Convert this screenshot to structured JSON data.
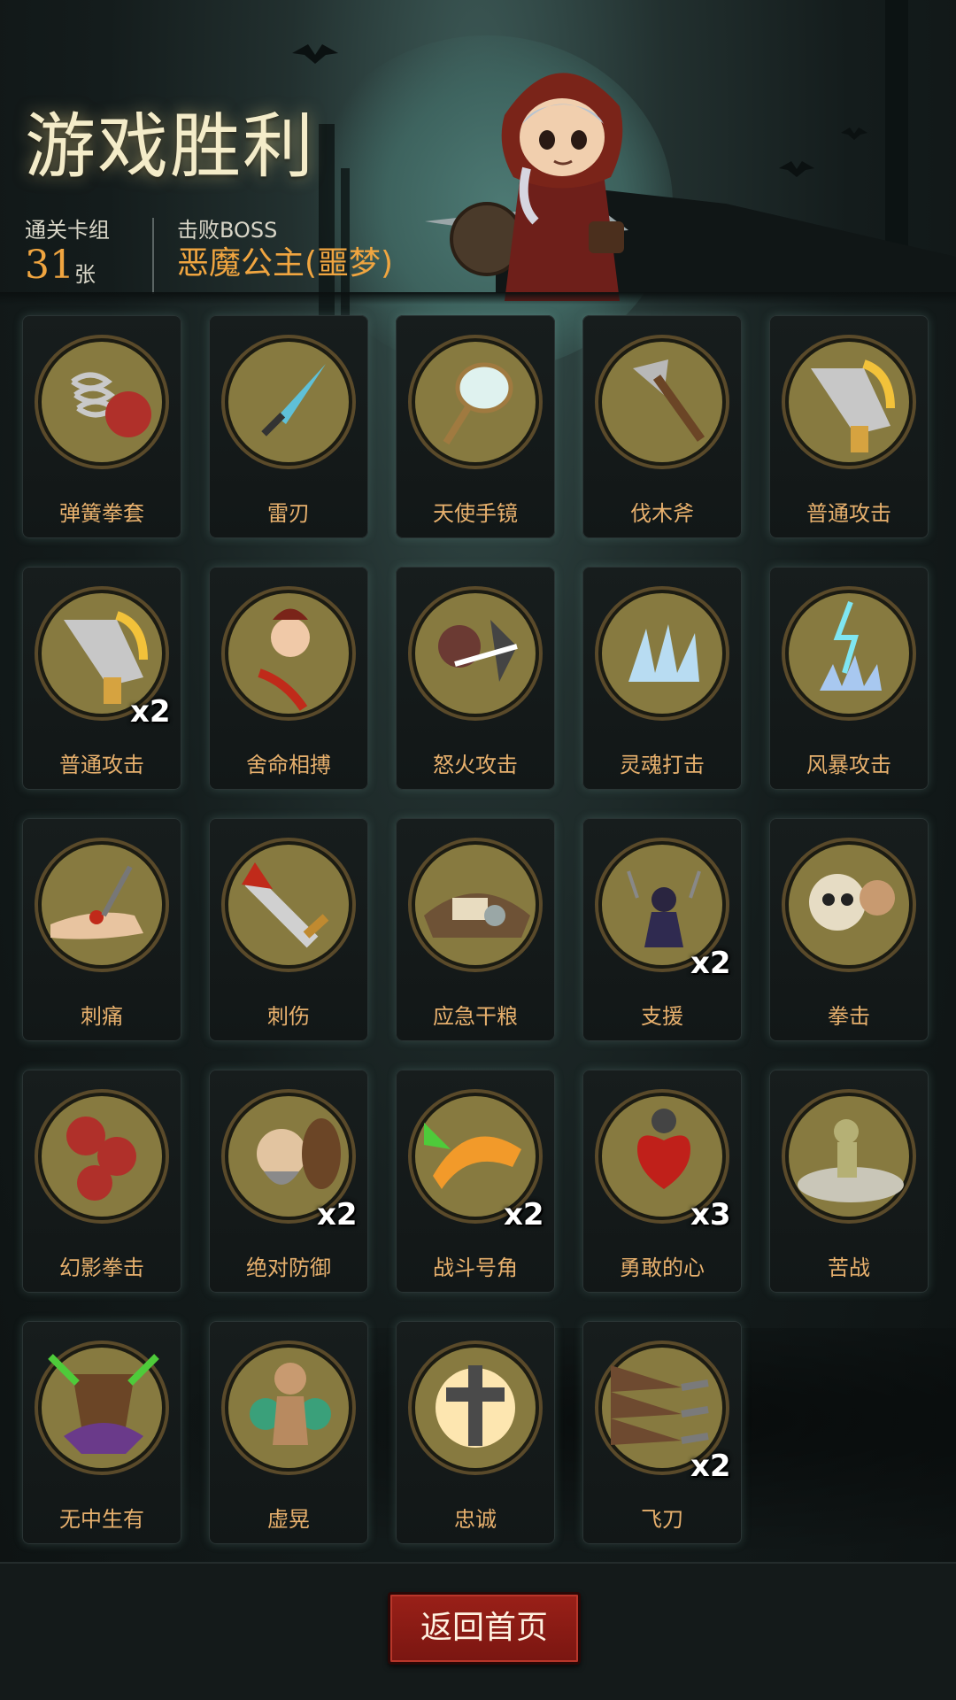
{
  "header": {
    "title": "游戏胜利",
    "deck_label": "通关卡组",
    "deck_count": "31",
    "deck_unit": "张",
    "boss_label": "击败BOSS",
    "boss_name": "恶魔公主(噩梦)"
  },
  "cards": [
    {
      "name": "弹簧拳套",
      "icon": "spring-glove-icon",
      "count": ""
    },
    {
      "name": "雷刃",
      "icon": "thunder-blade-icon",
      "count": ""
    },
    {
      "name": "天使手镜",
      "icon": "angel-mirror-icon",
      "count": ""
    },
    {
      "name": "伐木斧",
      "icon": "axe-icon",
      "count": ""
    },
    {
      "name": "普通攻击",
      "icon": "sword-icon",
      "count": ""
    },
    {
      "name": "普通攻击",
      "icon": "sword-icon",
      "count": "x2"
    },
    {
      "name": "舍命相搏",
      "icon": "desperate-fight-icon",
      "count": ""
    },
    {
      "name": "怒火攻击",
      "icon": "rage-attack-icon",
      "count": ""
    },
    {
      "name": "灵魂打击",
      "icon": "soul-strike-icon",
      "count": ""
    },
    {
      "name": "风暴攻击",
      "icon": "storm-attack-icon",
      "count": ""
    },
    {
      "name": "刺痛",
      "icon": "sting-icon",
      "count": ""
    },
    {
      "name": "刺伤",
      "icon": "stab-icon",
      "count": ""
    },
    {
      "name": "应急干粮",
      "icon": "rations-icon",
      "count": ""
    },
    {
      "name": "支援",
      "icon": "support-icon",
      "count": "x2"
    },
    {
      "name": "拳击",
      "icon": "skull-punch-icon",
      "count": ""
    },
    {
      "name": "幻影拳击",
      "icon": "phantom-punch-icon",
      "count": ""
    },
    {
      "name": "绝对防御",
      "icon": "dwarf-shield-icon",
      "count": "x2"
    },
    {
      "name": "战斗号角",
      "icon": "war-horn-icon",
      "count": "x2"
    },
    {
      "name": "勇敢的心",
      "icon": "brave-heart-icon",
      "count": "x3"
    },
    {
      "name": "苦战",
      "icon": "hard-fight-icon",
      "count": ""
    },
    {
      "name": "无中生有",
      "icon": "conjure-icon",
      "count": ""
    },
    {
      "name": "虚晃",
      "icon": "boxer-feint-icon",
      "count": ""
    },
    {
      "name": "忠诚",
      "icon": "cross-icon",
      "count": ""
    },
    {
      "name": "飞刀",
      "icon": "throwing-knives-icon",
      "count": "x2"
    }
  ],
  "footer": {
    "home_label": "返回首页"
  },
  "colors": {
    "accent": "#f0a540",
    "card_label": "#e7b06d",
    "medallion": "#877a40",
    "button": "#8c1c15"
  }
}
